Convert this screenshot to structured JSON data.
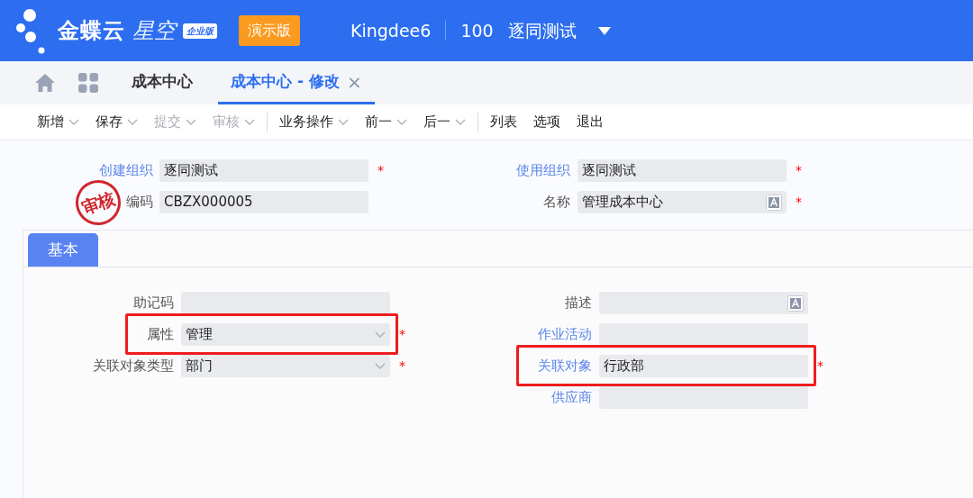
{
  "header": {
    "logo_text": "金蝶云",
    "logo_product": "星空",
    "edition_badge": "企业版",
    "demo_button": "演示版",
    "user": "Kingdee6",
    "org_code": "100",
    "org_name": "逐同测试"
  },
  "tabs": [
    {
      "label": "成本中心",
      "selected": false
    },
    {
      "label": "成本中心 - 修改",
      "selected": true,
      "close": "×"
    }
  ],
  "toolbar": [
    {
      "label": "新增",
      "disabled": false,
      "separator_after": false
    },
    {
      "label": "保存",
      "disabled": false,
      "separator_after": false
    },
    {
      "label": "提交",
      "disabled": true,
      "separator_after": false
    },
    {
      "label": "审核",
      "disabled": true,
      "separator_after": true
    },
    {
      "label": "业务操作",
      "disabled": false,
      "separator_after": false
    },
    {
      "label": "前一",
      "disabled": false,
      "separator_after": false
    },
    {
      "label": "后一",
      "disabled": false,
      "separator_after": true
    },
    {
      "label": "列表",
      "disabled": false,
      "separator_after": false,
      "menu": false
    },
    {
      "label": "选项",
      "disabled": false,
      "separator_after": false,
      "menu": false
    },
    {
      "label": "退出",
      "disabled": false,
      "separator_after": false,
      "menu": false
    }
  ],
  "stamp": "审核",
  "head_fields": [
    {
      "label": "创建组织",
      "link": true,
      "value": "逐同测试",
      "kind": "text",
      "required_mark": "*",
      "highlighted": false
    },
    {
      "label": "使用组织",
      "link": true,
      "value": "逐同测试",
      "kind": "text",
      "required_mark": "*",
      "highlighted": false
    },
    {
      "label": "编码",
      "link": false,
      "value": "CBZX000005",
      "kind": "text",
      "highlighted": false
    },
    {
      "label": "名称",
      "link": false,
      "value": "管理成本中心",
      "kind": "lang",
      "required_mark": "*",
      "highlighted": false
    }
  ],
  "section_tabs": [
    {
      "label": "基本",
      "selected": true
    }
  ],
  "left_fields": [
    {
      "label": "助记码",
      "link": false,
      "kind": "text",
      "highlighted": false
    },
    {
      "label": "属性",
      "link": false,
      "value": "管理",
      "kind": "select",
      "required_mark": "*",
      "highlighted": true
    },
    {
      "label": "关联对象类型",
      "link": false,
      "value": "部门",
      "kind": "select",
      "required_mark": "*",
      "highlighted": false
    }
  ],
  "right_fields": [
    {
      "label": "描述",
      "link": false,
      "kind": "lang",
      "highlighted": false
    },
    {
      "label": "作业活动",
      "link": true,
      "kind": "text",
      "highlighted": false
    },
    {
      "label": "关联对象",
      "link": true,
      "value": "行政部",
      "kind": "text",
      "required_mark": "*",
      "highlighted": true
    },
    {
      "label": "供应商",
      "link": true,
      "kind": "text",
      "highlighted": false
    }
  ]
}
